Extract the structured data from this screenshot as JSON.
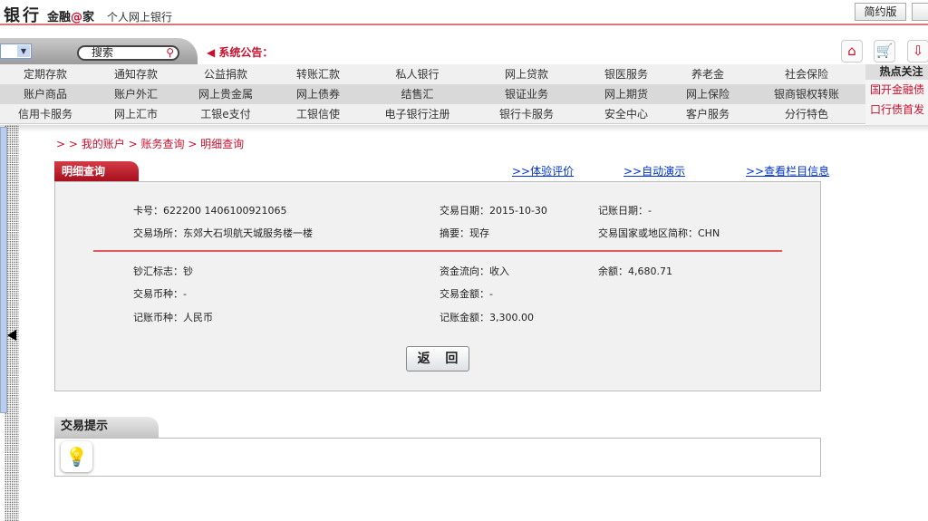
{
  "header": {
    "bank": "银行",
    "brand_prefix": "金融",
    "brand_at": "@",
    "brand_suffix": "家",
    "subtitle": "个人网上银行",
    "buttons": [
      "简约版",
      ""
    ]
  },
  "toolbar": {
    "search_placeholder": "搜索",
    "notice_label": "系统公告：",
    "icons": [
      "home-icon",
      "cart-icon",
      "download-mail-icon"
    ]
  },
  "menu": {
    "rows": [
      [
        "定期存款",
        "通知存款",
        "公益捐款",
        "转账汇款",
        "私人银行",
        "网上贷款",
        "银医服务",
        "养老金",
        "社会保险"
      ],
      [
        "账户商品",
        "账户外汇",
        "网上贵金属",
        "网上债券",
        "结售汇",
        "银证业务",
        "网上期货",
        "网上保险",
        "银商银权转账"
      ],
      [
        "信用卡服务",
        "网上汇市",
        "工银e支付",
        "工银信使",
        "电子银行注册",
        "银行卡服务",
        "安全中心",
        "客户服务",
        "分行特色"
      ]
    ]
  },
  "hot": {
    "title": "热点关注",
    "items": [
      "国开金融债",
      "口行债首发"
    ]
  },
  "breadcrumb": {
    "prefix": "> >",
    "items": [
      "我的账户",
      "账务查询",
      "明细查询"
    ]
  },
  "detail": {
    "tab": "明细查询",
    "links": [
      ">>体验评价",
      ">>自动演示",
      ">>查看栏目信息"
    ],
    "fields": {
      "card": "卡号：622200 1406100921065",
      "trade_date": "交易日期：2015-10-30",
      "post_date": "记账日期：-",
      "place": "交易场所：东郊大石坝航天城服务楼一楼",
      "summary": "摘要：现存",
      "country": "交易国家或地区简称：CHN",
      "cash_flag": "钞汇标志：钞",
      "flow": "资金流向：收入",
      "balance": "余额：4,680.71",
      "trade_currency": "交易币种：-",
      "trade_amount": "交易金额：-",
      "post_currency": "记账币种：人民币",
      "post_amount": "记账金额：3,300.00"
    },
    "back": "返 回"
  },
  "tips": {
    "title": "交易提示"
  }
}
